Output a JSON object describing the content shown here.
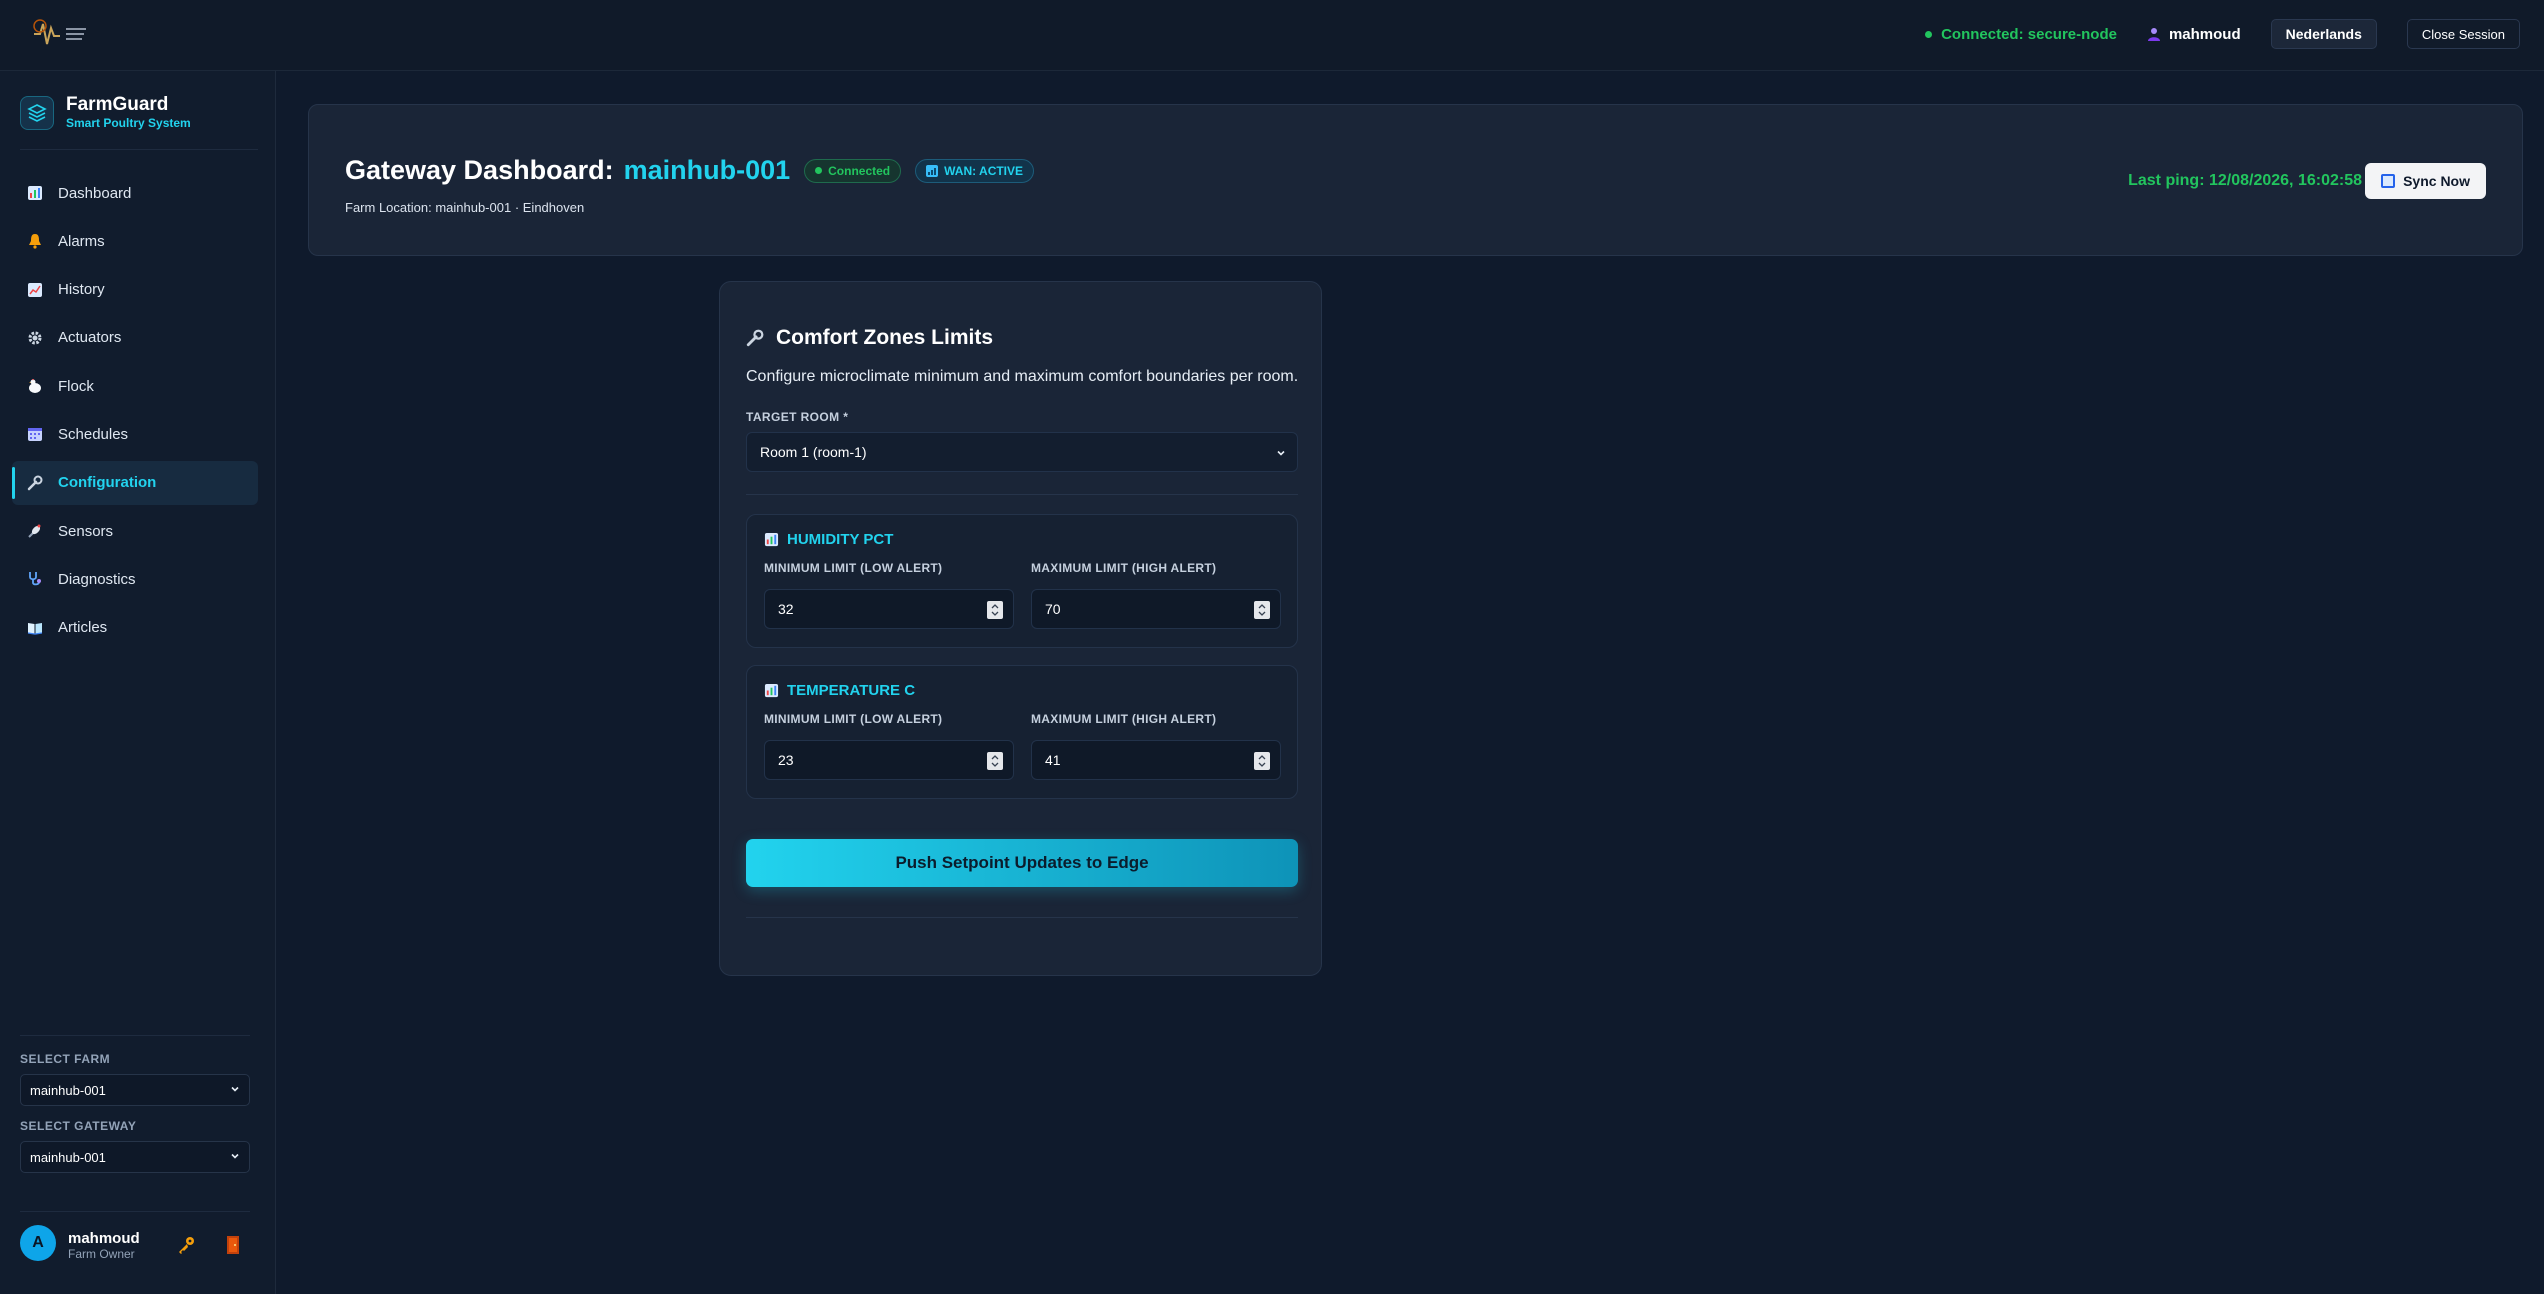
{
  "topbar": {
    "connection_status": "Connected: secure-node",
    "user": "mahmoud",
    "language_button": "Nederlands",
    "close_session_button": "Close Session"
  },
  "sidebar": {
    "brand_name": "FarmGuard",
    "brand_subtitle": "Smart Poultry System",
    "items": [
      {
        "label": "Dashboard",
        "icon": "bar-chart-icon"
      },
      {
        "label": "Alarms",
        "icon": "bell-icon"
      },
      {
        "label": "History",
        "icon": "line-chart-icon"
      },
      {
        "label": "Actuators",
        "icon": "gear-icon"
      },
      {
        "label": "Flock",
        "icon": "chicken-icon"
      },
      {
        "label": "Schedules",
        "icon": "calendar-icon"
      },
      {
        "label": "Configuration",
        "icon": "wrench-icon",
        "active": true
      },
      {
        "label": "Sensors",
        "icon": "satellite-icon"
      },
      {
        "label": "Diagnostics",
        "icon": "stethoscope-icon"
      },
      {
        "label": "Articles",
        "icon": "book-icon"
      }
    ],
    "select_farm_label": "SELECT FARM",
    "select_farm_value": "mainhub-001",
    "select_gateway_label": "SELECT GATEWAY",
    "select_gateway_value": "mainhub-001",
    "user_initial": "A",
    "user_name": "mahmoud",
    "user_role": "Farm Owner"
  },
  "header": {
    "title_prefix": "Gateway Dashboard:",
    "gateway_id": "mainhub-001",
    "status_badge": "Connected",
    "wan_badge": "WAN: ACTIVE",
    "farm_location": "Farm Location: mainhub-001 · Eindhoven",
    "last_ping": "Last ping: 12/08/2026, 16:02:58",
    "sync_button": "Sync Now"
  },
  "panel": {
    "title": "Comfort Zones Limits",
    "description": "Configure microclimate minimum and maximum comfort boundaries per room.",
    "target_room_label": "TARGET ROOM *",
    "target_room_value": "Room 1 (room-1)",
    "zones": [
      {
        "title": "HUMIDITY PCT",
        "min_label": "MINIMUM LIMIT (LOW ALERT)",
        "max_label": "MAXIMUM LIMIT (HIGH ALERT)",
        "min_value": "32",
        "max_value": "70"
      },
      {
        "title": "TEMPERATURE C",
        "min_label": "MINIMUM LIMIT (LOW ALERT)",
        "max_label": "MAXIMUM LIMIT (HIGH ALERT)",
        "min_value": "23",
        "max_value": "41"
      }
    ],
    "push_button": "Push Setpoint Updates to Edge"
  },
  "colors": {
    "accent": "#22d3ee",
    "success": "#22c55e",
    "background": "#0f1a2c",
    "card": "#1a2537"
  }
}
